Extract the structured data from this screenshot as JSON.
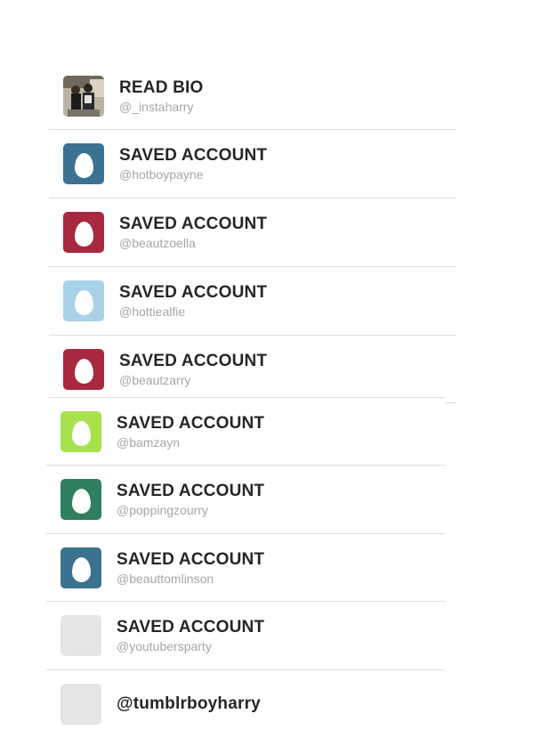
{
  "accounts": [
    {
      "title": "READ BIO",
      "handle": "@_instaharry",
      "avatar": "photo"
    },
    {
      "title": "SAVED ACCOUNT",
      "handle": "@hotboypayne",
      "avatar_color": "#3b7290",
      "avatar": "egg-icon"
    },
    {
      "title": "SAVED ACCOUNT",
      "handle": "@beautzoella",
      "avatar_color": "#a6293f",
      "avatar": "egg-icon"
    },
    {
      "title": "SAVED ACCOUNT",
      "handle": "@hottiealfie",
      "avatar_color": "#a8d2e8",
      "avatar": "egg-icon"
    },
    {
      "title": "SAVED ACCOUNT",
      "handle": "@beautzarry",
      "avatar_color": "#a6293f",
      "avatar": "egg-icon"
    },
    {
      "title": "SAVED ACCOUNT",
      "handle": "@bamzayn",
      "avatar_color": "#a8e04e",
      "avatar": "egg-icon"
    },
    {
      "title": "SAVED ACCOUNT",
      "handle": "@poppingzourry",
      "avatar_color": "#2f7e5f",
      "avatar": "egg-icon"
    },
    {
      "title": "SAVED ACCOUNT",
      "handle": "@beauttomlinson",
      "avatar_color": "#3b7290",
      "avatar": "egg-icon"
    },
    {
      "title": "SAVED ACCOUNT",
      "handle": "@youtubersparty",
      "avatar_color": "#e5e5e5",
      "avatar": "blank"
    },
    {
      "title": "@tumblrboyharry",
      "handle": "",
      "avatar_color": "#e5e5e5",
      "avatar": "blank"
    }
  ]
}
